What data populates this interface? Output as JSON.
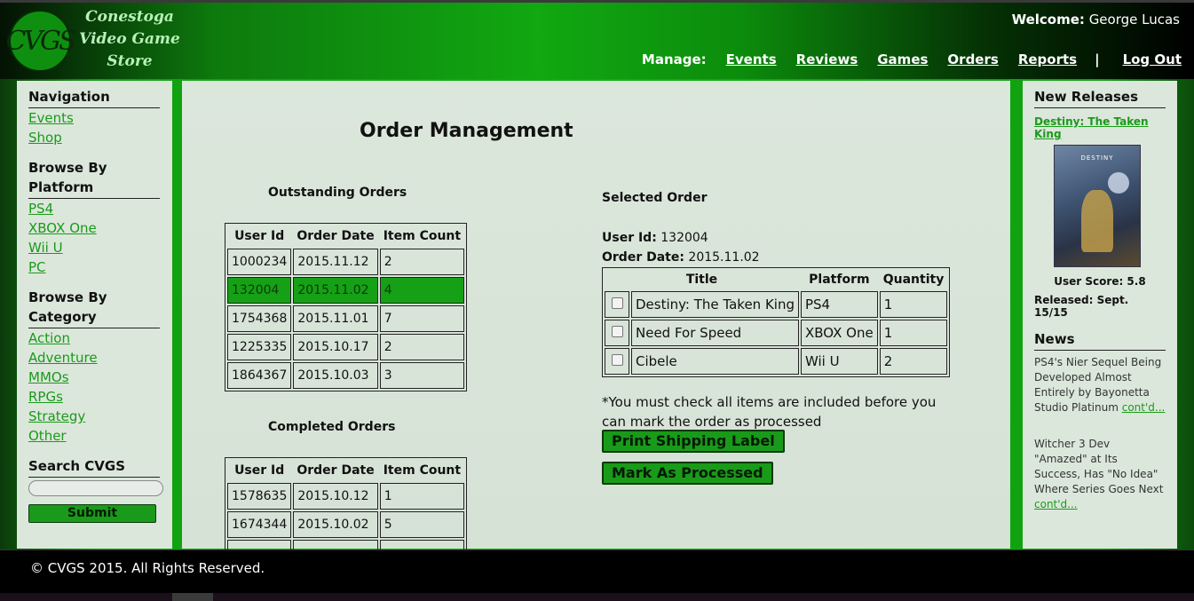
{
  "header": {
    "logo_letters": "CVGS",
    "logo_text": [
      "Conestoga",
      "Video Game",
      "Store"
    ],
    "welcome_label": "Welcome:",
    "welcome_user": "George Lucas",
    "manage_label": "Manage:",
    "nav": [
      "Events",
      "Reviews",
      "Games",
      "Orders",
      "Reports"
    ],
    "separator": "|",
    "logout": "Log Out"
  },
  "left": {
    "navigation_h": "Navigation",
    "navigation": [
      "Events",
      "Shop"
    ],
    "platform_h": "Browse By Platform",
    "platforms": [
      "PS4",
      "XBOX One",
      "Wii U",
      "PC"
    ],
    "category_h": "Browse By Category",
    "categories": [
      "Action",
      "Adventure",
      "MMOs",
      "RPGs",
      "Strategy",
      "Other"
    ],
    "search_h": "Search CVGS",
    "search_value": "",
    "submit": "Submit"
  },
  "main": {
    "title": "Order Management",
    "outstanding_h": "Outstanding Orders",
    "completed_h": "Completed Orders",
    "columns": [
      "User Id",
      "Order Date",
      "Item Count"
    ],
    "outstanding": [
      {
        "user": "1000234",
        "date": "2015.11.12",
        "count": "2",
        "selected": false
      },
      {
        "user": "132004",
        "date": "2015.11.02",
        "count": "4",
        "selected": true
      },
      {
        "user": "1754368",
        "date": "2015.11.01",
        "count": "7",
        "selected": false
      },
      {
        "user": "1225335",
        "date": "2015.10.17",
        "count": "2",
        "selected": false
      },
      {
        "user": "1864367",
        "date": "2015.10.03",
        "count": "3",
        "selected": false
      }
    ],
    "completed": [
      {
        "user": "1578635",
        "date": "2015.10.12",
        "count": "1"
      },
      {
        "user": "1674344",
        "date": "2015.10.02",
        "count": "5"
      }
    ],
    "selected_h": "Selected Order",
    "sel_user_label": "User Id:",
    "sel_user": "132004",
    "sel_date_label": "Order Date:",
    "sel_date": "2015.11.02",
    "item_columns": [
      "Title",
      "Platform",
      "Quantity"
    ],
    "items": [
      {
        "title": "Destiny: The Taken King",
        "platform": "PS4",
        "qty": "1"
      },
      {
        "title": "Need For Speed",
        "platform": "XBOX One",
        "qty": "1"
      },
      {
        "title": "Cibele",
        "platform": "Wii U",
        "qty": "2"
      }
    ],
    "note": "*You must check all items are included before you can mark the order as processed",
    "print_btn": "Print Shipping Label",
    "processed_btn": "Mark As Processed"
  },
  "right": {
    "releases_h": "New Releases",
    "release_title": "Destiny: The Taken King",
    "cover_text": "DESTINY",
    "user_score": "User Score: 5.8",
    "released": "Released: Sept. 15/15",
    "news_h": "News",
    "news": [
      {
        "text": "PS4's Nier Sequel Being Developed Almost Entirely by Bayonetta Studio Platinum ",
        "link": "cont'd..."
      },
      {
        "text": "Witcher 3 Dev \"Amazed\" at Its Success, Has \"No Idea\" Where Series Goes Next ",
        "link": "cont'd..."
      }
    ]
  },
  "footer": {
    "copyright": "© CVGS 2015. All Rights Reserved."
  }
}
